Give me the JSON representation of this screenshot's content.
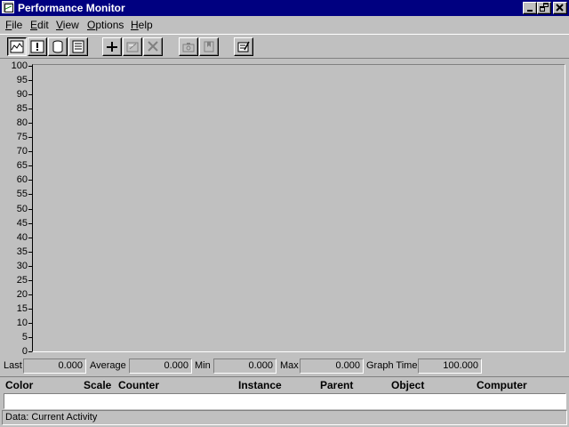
{
  "window": {
    "title": "Performance Monitor"
  },
  "menu": [
    {
      "label": "File",
      "accel": "F",
      "rest": "ile"
    },
    {
      "label": "Edit",
      "accel": "E",
      "rest": "dit"
    },
    {
      "label": "View",
      "accel": "V",
      "rest": "iew"
    },
    {
      "label": "Options",
      "accel": "O",
      "rest": "ptions"
    },
    {
      "label": "Help",
      "accel": "H",
      "rest": "elp"
    }
  ],
  "toolbar": {
    "buttons": [
      {
        "name": "chart-view-icon",
        "pressed": true
      },
      {
        "name": "alert-view-icon",
        "pressed": false
      },
      {
        "name": "log-view-icon",
        "pressed": false
      },
      {
        "name": "report-view-icon",
        "pressed": false
      },
      {
        "name": "add-counter-icon",
        "pressed": false
      },
      {
        "name": "edit-counter-icon",
        "pressed": false,
        "disabled": true
      },
      {
        "name": "delete-counter-icon",
        "pressed": false,
        "disabled": true
      },
      {
        "name": "update-now-icon",
        "pressed": false,
        "disabled": true
      },
      {
        "name": "bookmark-icon",
        "pressed": false,
        "disabled": true
      },
      {
        "name": "options-icon",
        "pressed": false
      }
    ]
  },
  "chart_data": {
    "type": "line",
    "ylim": [
      0,
      100
    ],
    "yticks": [
      "100",
      "95",
      "90",
      "85",
      "80",
      "75",
      "70",
      "65",
      "60",
      "55",
      "50",
      "45",
      "40",
      "35",
      "30",
      "25",
      "20",
      "15",
      "10",
      "5",
      "0"
    ],
    "series": [],
    "grid": false
  },
  "stats": {
    "last_label": "Last",
    "last_value": "0.000",
    "average_label": "Average",
    "average_value": "0.000",
    "min_label": "Min",
    "min_value": "0.000",
    "max_label": "Max",
    "max_value": "0.000",
    "graph_time_label": "Graph Time",
    "graph_time_value": "100.000"
  },
  "legend": {
    "columns": [
      "Color",
      "Scale",
      "Counter",
      "Instance",
      "Parent",
      "Object",
      "Computer"
    ]
  },
  "status": {
    "text": "Data: Current Activity"
  }
}
